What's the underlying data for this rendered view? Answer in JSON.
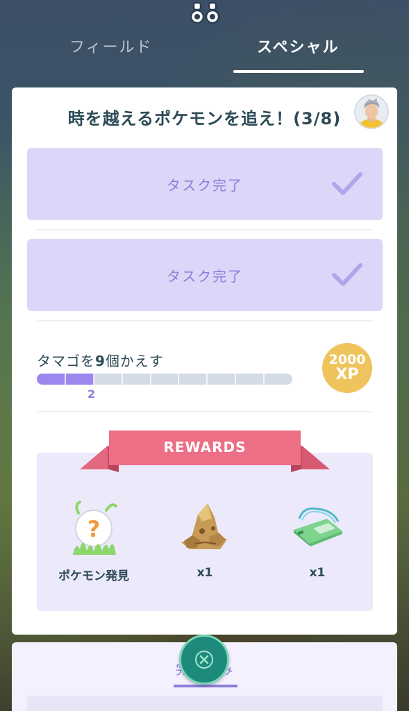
{
  "tabs": {
    "field_label": "フィールド",
    "special_label": "スペシャル",
    "active": "special"
  },
  "quest": {
    "title": "時を越えるポケモンを追え！(3/8)",
    "tasks_done": [
      {
        "label": "タスク完了"
      },
      {
        "label": "タスク完了"
      }
    ],
    "current_task": {
      "prefix": "タマゴを",
      "count": "9",
      "suffix": "個かえす",
      "progress_label": "2",
      "progress": 2,
      "total": 9,
      "reward_xp_amount": "2000",
      "reward_xp_unit": "XP"
    }
  },
  "rewards": {
    "banner": "REWARDS",
    "items": [
      {
        "icon": "pokemon-encounter-icon",
        "caption": "ポケモン発見"
      },
      {
        "icon": "ancient-fossil-icon",
        "caption": "x1"
      },
      {
        "icon": "green-ticket-icon",
        "caption": "x1"
      }
    ]
  },
  "bottom": {
    "tab_label": "完了済み"
  },
  "colors": {
    "accent": "#8a7ed8",
    "task_done_bg": "#dcd6f9",
    "ribbon": "#ec6f86",
    "xp_badge": "#f0c45c",
    "close_button": "#1d8a7c"
  }
}
